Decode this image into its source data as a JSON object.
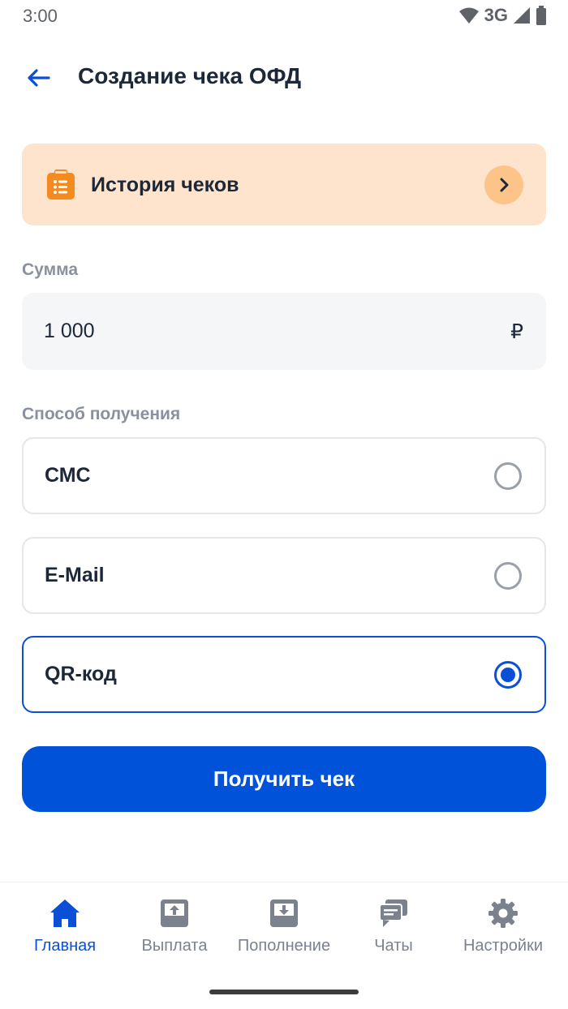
{
  "status_bar": {
    "time": "3:00",
    "network": "3G",
    "icons": [
      "wifi-icon",
      "signal-icon",
      "battery-icon"
    ]
  },
  "header": {
    "title": "Создание чека ОФД",
    "back_icon": "arrow-left-icon"
  },
  "history_card": {
    "label": "История чеков",
    "icon": "clipboard-list-icon",
    "chevron_icon": "chevron-right-icon"
  },
  "amount": {
    "label": "Сумма",
    "value": "1 000",
    "currency": "₽"
  },
  "delivery": {
    "label": "Способ получения",
    "options": [
      {
        "label": "СМС",
        "selected": false
      },
      {
        "label": "E-Mail",
        "selected": false
      },
      {
        "label": "QR-код",
        "selected": true
      }
    ]
  },
  "submit_button": {
    "label": "Получить чек"
  },
  "bottom_nav": {
    "items": [
      {
        "label": "Главная",
        "icon": "home-icon",
        "active": true
      },
      {
        "label": "Выплата",
        "icon": "upload-tray-icon",
        "active": false
      },
      {
        "label": "Пополнение",
        "icon": "download-tray-icon",
        "active": false
      },
      {
        "label": "Чаты",
        "icon": "chat-icon",
        "active": false
      },
      {
        "label": "Настройки",
        "icon": "gear-icon",
        "active": false
      }
    ]
  },
  "colors": {
    "accent": "#0052d9",
    "history_bg": "#fee4cc",
    "history_chevron_bg": "#fcc488",
    "history_icon": "#f58a1f",
    "text_primary": "#1c2738",
    "text_secondary": "#8a919c",
    "nav_inactive": "#7b828d"
  }
}
